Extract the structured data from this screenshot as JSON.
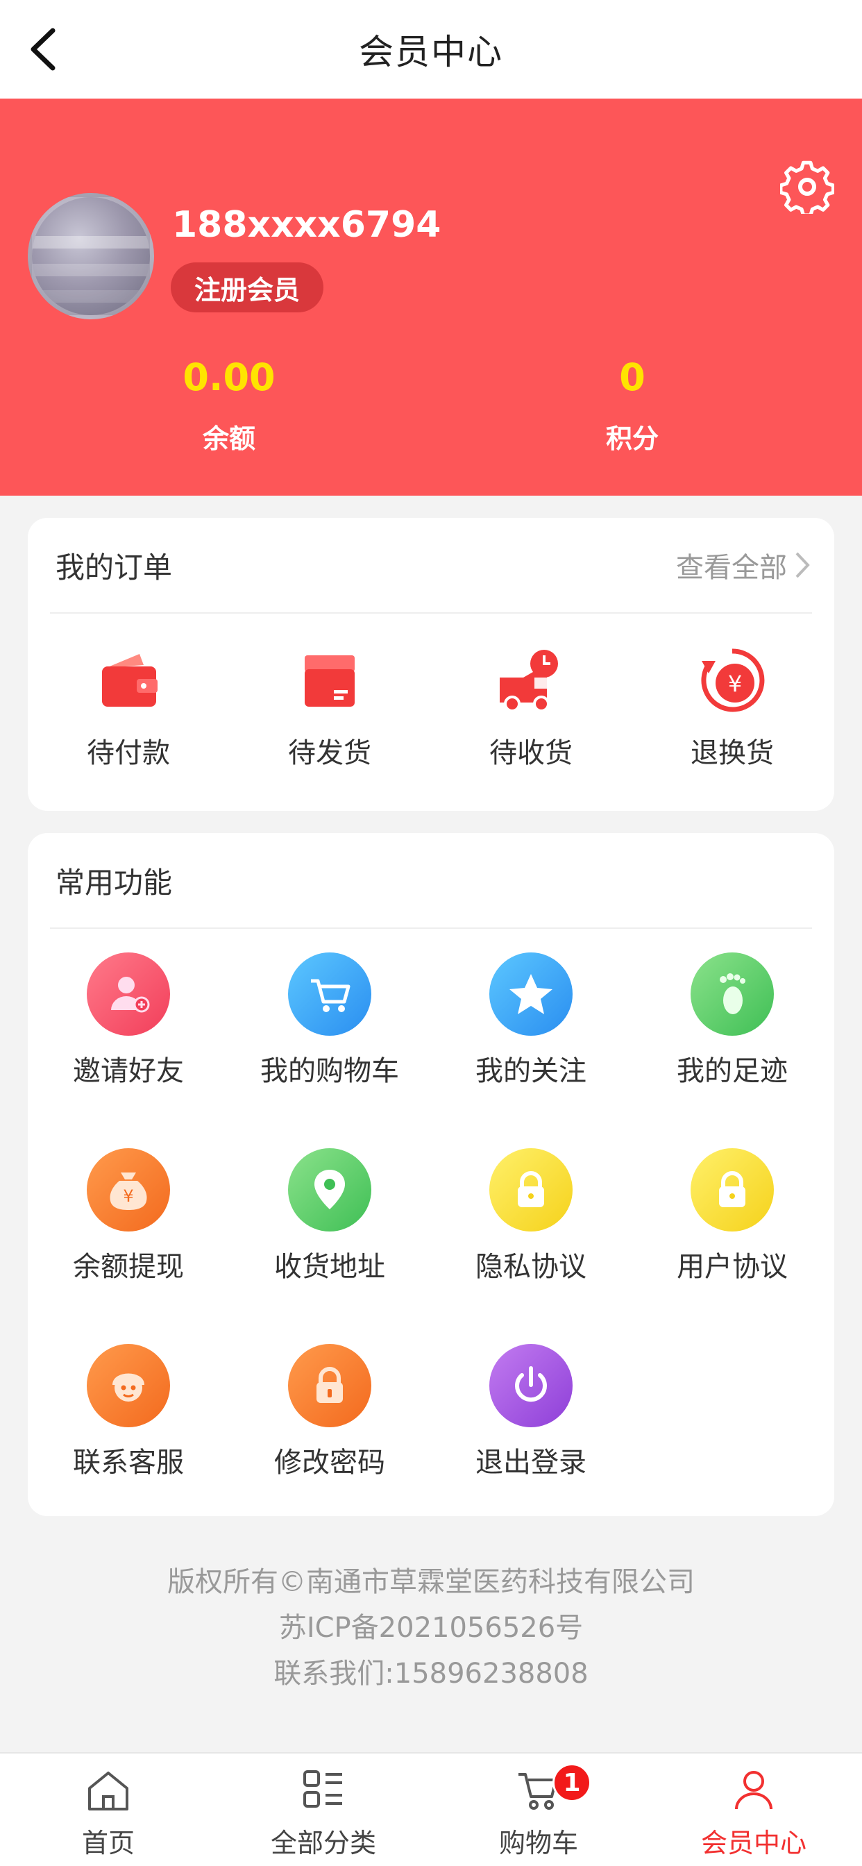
{
  "header": {
    "title": "会员中心"
  },
  "profile": {
    "phone": "188xxxx6794",
    "member_tag": "注册会员",
    "balance": {
      "value": "0.00",
      "label": "余额"
    },
    "points": {
      "value": "0",
      "label": "积分"
    }
  },
  "orders": {
    "title": "我的订单",
    "view_all": "查看全部",
    "items": [
      {
        "label": "待付款",
        "icon": "wallet-icon"
      },
      {
        "label": "待发货",
        "icon": "box-icon"
      },
      {
        "label": "待收货",
        "icon": "delivery-truck-icon"
      },
      {
        "label": "退换货",
        "icon": "refund-yen-icon"
      }
    ]
  },
  "functions": {
    "title": "常用功能",
    "items": [
      {
        "label": "邀请好友",
        "icon": "add-user-icon"
      },
      {
        "label": "我的购物车",
        "icon": "cart-icon"
      },
      {
        "label": "我的关注",
        "icon": "star-icon"
      },
      {
        "label": "我的足迹",
        "icon": "footprint-icon"
      },
      {
        "label": "余额提现",
        "icon": "money-bag-icon"
      },
      {
        "label": "收货地址",
        "icon": "location-pin-icon"
      },
      {
        "label": "隐私协议",
        "icon": "lock-icon"
      },
      {
        "label": "用户协议",
        "icon": "lock-icon"
      },
      {
        "label": "联系客服",
        "icon": "customer-service-icon"
      },
      {
        "label": "修改密码",
        "icon": "password-lock-icon"
      },
      {
        "label": "退出登录",
        "icon": "power-icon"
      }
    ]
  },
  "footer": {
    "copyright": "版权所有©南通市草霖堂医药科技有限公司",
    "icp": "苏ICP备2021056526号",
    "contact": "联系我们:15896238808"
  },
  "tabbar": {
    "items": [
      {
        "label": "首页",
        "icon": "home-icon"
      },
      {
        "label": "全部分类",
        "icon": "category-icon"
      },
      {
        "label": "购物车",
        "icon": "cart-icon",
        "badge": "1"
      },
      {
        "label": "会员中心",
        "icon": "user-icon",
        "active": true
      }
    ]
  },
  "colors": {
    "brand_red": "#fd5658",
    "highlight_yellow": "#ffe400",
    "active_tab": "#f23030"
  }
}
